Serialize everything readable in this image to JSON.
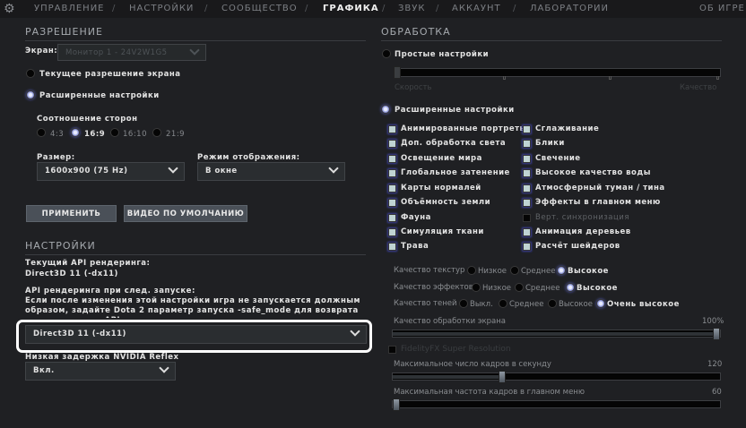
{
  "nav": {
    "items": [
      "УПРАВЛЕНИЕ",
      "НАСТРОЙКИ",
      "СООБЩЕСТВО",
      "ГРАФИКА",
      "ЗВУК",
      "АККАУНТ",
      "ЛАБОРАТОРИИ"
    ],
    "active": "ГРАФИКА",
    "about": "ОБ ИГРЕ"
  },
  "resolution": {
    "title": "РАЗРЕШЕНИЕ",
    "screen_label": "Экран:",
    "screen_value": "Монитор 1 - 24V2W1G5",
    "current_res": "Текущее разрешение экрана",
    "advanced": "Расширенные настройки",
    "aspect_label": "Соотношение сторон",
    "aspects": [
      "4:3",
      "16:9",
      "16:10",
      "21:9"
    ],
    "aspect_selected": "16:9",
    "size_label": "Размер:",
    "size_value": "1600x900 (75 Hz)",
    "mode_label": "Режим отображения:",
    "mode_value": "В окне",
    "apply": "ПРИМЕНИТЬ",
    "default_video": "ВИДЕО ПО УМОЛЧАНИЮ"
  },
  "settings": {
    "title": "НАСТРОЙКИ",
    "current_api_label": "Текущий API рендеринга:",
    "current_api": "Direct3D 11 (-dx11)",
    "next_api_label": "API рендеринга при след. запуске:",
    "warning": "Если после изменения этой настройки игра не запускается должным образом, задайте Dota 2 параметр запуска -safe_mode для возврата к стандартному API.",
    "next_api_value": "Direct3D 11 (-dx11)",
    "reflex_label": "Низкая задержка NVIDIA Reflex",
    "reflex_value": "Вкл."
  },
  "processing": {
    "title": "ОБРАБОТКА",
    "simple": "Простые настройки",
    "speed": "Скорость",
    "quality": "Качество",
    "advanced": "Расширенные настройки",
    "col1": [
      {
        "label": "Анимированные портреты",
        "checked": true
      },
      {
        "label": "Доп. обработка света",
        "checked": true
      },
      {
        "label": "Освещение мира",
        "checked": true
      },
      {
        "label": "Глобальное затенение",
        "checked": true
      },
      {
        "label": "Карты нормалей",
        "checked": true
      },
      {
        "label": "Объёмность земли",
        "checked": true
      },
      {
        "label": "Фауна",
        "checked": true
      },
      {
        "label": "Симуляция ткани",
        "checked": true
      },
      {
        "label": "Трава",
        "checked": true
      }
    ],
    "col2": [
      {
        "label": "Сглаживание",
        "checked": true
      },
      {
        "label": "Блики",
        "checked": true
      },
      {
        "label": "Свечение",
        "checked": true
      },
      {
        "label": "Высокое качество воды",
        "checked": true
      },
      {
        "label": "Атмосферный туман / тина",
        "checked": true
      },
      {
        "label": "Эффекты в главном меню",
        "checked": true
      },
      {
        "label": "Верт. синхронизация",
        "checked": false
      },
      {
        "label": "Анимация деревьев",
        "checked": true
      },
      {
        "label": "Расчёт шейдеров",
        "checked": true
      }
    ],
    "quality_rows": [
      {
        "label": "Качество текстур",
        "options": [
          "Низкое",
          "Среднее",
          "Высокое"
        ],
        "selected": 2
      },
      {
        "label": "Качество эффектов",
        "options": [
          "Низкое",
          "Среднее",
          "Высокое"
        ],
        "selected": 2
      },
      {
        "label": "Качество теней",
        "options": [
          "Выкл.",
          "Среднее",
          "Высокое",
          "Очень высокое"
        ],
        "selected": 3
      }
    ],
    "screen_quality_label": "Качество обработки экрана",
    "screen_quality_value": "100%",
    "screen_quality_fraction": 1.0,
    "fsr": "FidelityFX Super Resolution",
    "max_fps_label": "Максимальное число кадров в секунду",
    "max_fps_value": "120",
    "max_fps_fraction": 0.33,
    "menu_fps_label": "Максимальная частота кадров в главном меню",
    "menu_fps_value": "60",
    "menu_fps_fraction": 0.0
  }
}
